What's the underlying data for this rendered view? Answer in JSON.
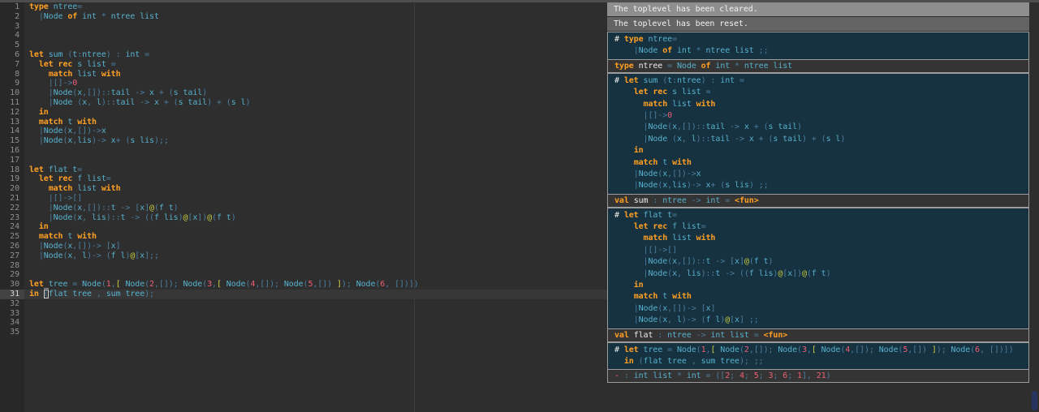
{
  "colors": {
    "keyword": "#ffa024",
    "identifier": "#57b1ce",
    "operator": "#4c7e9e",
    "number": "#ef5e76",
    "append_bracket": "#c9cd41",
    "plain_text": "#ebebeb",
    "editor_bg": "#2e2e2e",
    "gutter_bg": "#282828",
    "active_line_bg": "#373737",
    "gutter_active_bg": "#424242",
    "line_number": "#8f8f8f",
    "input_block_bg": "#16313f",
    "output_block_bg": "#343434",
    "separator": "#9c9c9c",
    "msg_cleared_bg": "#8e8e8e",
    "msg_reset_bg": "#646464",
    "msg_text": "#f2f2f2"
  },
  "editor": {
    "line_count": 35,
    "active_line": 31,
    "cursor": {
      "line": 31,
      "ch": 3
    },
    "space_underline": {
      "line": 30,
      "ch": 3
    },
    "lines": [
      "type ntree=",
      "  |Node of int * ntree list",
      "",
      "",
      "",
      "let sum (t:ntree) : int =",
      "  let rec s list =",
      "    match list with",
      "    |[]->0",
      "    |Node(x,[])::tail -> x + (s tail)",
      "    |Node (x, l)::tail -> x + (s tail) + (s l)",
      "  in",
      "  match t with",
      "  |Node(x,[])->x",
      "  |Node(x,lis)-> x+ (s lis);;",
      "",
      "",
      "let flat t=",
      "  let rec f list=",
      "    match list with",
      "    |[]->[]",
      "    |Node(x,[])::t -> [x]@(f t)",
      "    |Node(x, lis)::t -> ((f lis)@[x])@(f t)",
      "  in",
      "  match t with",
      "  |Node(x,[])-> [x]",
      "  |Node(x, l)-> (f l)@[x];;",
      "",
      "",
      "let tree = Node(1,[ Node(2,[]); Node(3,[ Node(4,[]); Node(5,[]) ]); Node(6, [])])",
      "in (flat tree , sum tree);",
      "",
      "",
      "",
      ""
    ]
  },
  "toplevel": {
    "messages": [
      "The toplevel has been cleared.",
      "The toplevel has been reset."
    ],
    "entries": [
      {
        "input": [
          "# type ntree=",
          "    |Node of int * ntree list ;;"
        ],
        "output": [
          "type ntree = Node of int * ntree list"
        ]
      },
      {
        "input": [
          "# let sum (t:ntree) : int =",
          "    let rec s list =",
          "      match list with",
          "      |[]->0",
          "      |Node(x,[])::tail -> x + (s tail)",
          "      |Node (x, l)::tail -> x + (s tail) + (s l)",
          "    in",
          "    match t with",
          "    |Node(x,[])->x",
          "    |Node(x,lis)-> x+ (s lis) ;;"
        ],
        "output": [
          "val sum : ntree -> int = <fun>"
        ]
      },
      {
        "input": [
          "# let flat t=",
          "    let rec f list=",
          "      match list with",
          "      |[]->[]",
          "      |Node(x,[])::t -> [x]@(f t)",
          "      |Node(x, lis)::t -> ((f lis)@[x])@(f t)",
          "    in",
          "    match t with",
          "    |Node(x,[])-> [x]",
          "    |Node(x, l)-> (f l)@[x] ;;"
        ],
        "output": [
          "val flat : ntree -> int list = <fun>"
        ]
      },
      {
        "input": [
          "# let tree = Node(1,[ Node(2,[]); Node(3,[ Node(4,[]); Node(5,[]) ]); Node(6, [])])",
          "  in (flat tree , sum tree); ;;"
        ],
        "output": [
          "- : int list * int = ([2; 4; 5; 3; 6; 1], 21)"
        ]
      }
    ]
  }
}
